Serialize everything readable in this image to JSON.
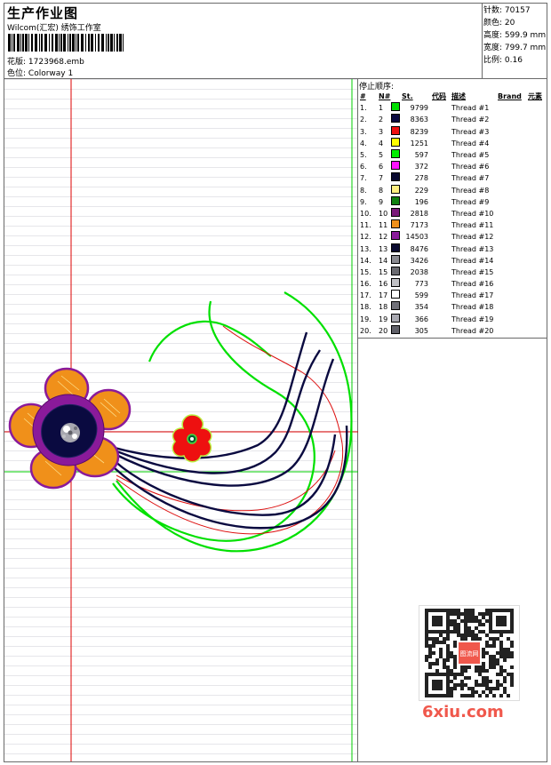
{
  "header": {
    "title": "生产作业图",
    "subtitle": "Wilcom(汇宏) 绣饰工作室",
    "design_label": "花版:",
    "design_value": "1723968.emb",
    "colorway_label": "色位:",
    "colorway_value": "Colorway 1"
  },
  "stats": [
    {
      "label": "针数:",
      "value": "70157"
    },
    {
      "label": "颜色:",
      "value": "20"
    },
    {
      "label": "高度:",
      "value": "599.9 mm"
    },
    {
      "label": "宽度:",
      "value": "799.7 mm"
    },
    {
      "label": "比例:",
      "value": "0.16"
    }
  ],
  "threads_panel": {
    "title": "停止顺序:",
    "columns": [
      "#",
      "N#",
      "St.",
      "代码",
      "描述",
      "Brand",
      "元素"
    ],
    "rows": [
      {
        "idx": "1.",
        "no": "1",
        "color": "#00e000",
        "st": "9799",
        "desc": "Thread #1"
      },
      {
        "idx": "2.",
        "no": "2",
        "color": "#0a0a40",
        "st": "8363",
        "desc": "Thread #2"
      },
      {
        "idx": "3.",
        "no": "3",
        "color": "#ee1010",
        "st": "8239",
        "desc": "Thread #3"
      },
      {
        "idx": "4.",
        "no": "4",
        "color": "#ffff00",
        "st": "1251",
        "desc": "Thread #4"
      },
      {
        "idx": "5.",
        "no": "5",
        "color": "#00ee00",
        "st": "597",
        "desc": "Thread #5"
      },
      {
        "idx": "6.",
        "no": "6",
        "color": "#ff10ff",
        "st": "372",
        "desc": "Thread #6"
      },
      {
        "idx": "7.",
        "no": "7",
        "color": "#0a0a30",
        "st": "278",
        "desc": "Thread #7"
      },
      {
        "idx": "8.",
        "no": "8",
        "color": "#ffef80",
        "st": "229",
        "desc": "Thread #8"
      },
      {
        "idx": "9.",
        "no": "9",
        "color": "#108010",
        "st": "196",
        "desc": "Thread #9"
      },
      {
        "idx": "10.",
        "no": "10",
        "color": "#7a1a7a",
        "st": "2818",
        "desc": "Thread #10"
      },
      {
        "idx": "11.",
        "no": "11",
        "color": "#f0901a",
        "st": "7173",
        "desc": "Thread #11"
      },
      {
        "idx": "12.",
        "no": "12",
        "color": "#8a1a9a",
        "st": "14503",
        "desc": "Thread #12"
      },
      {
        "idx": "13.",
        "no": "13",
        "color": "#0a0a30",
        "st": "8476",
        "desc": "Thread #13"
      },
      {
        "idx": "14.",
        "no": "14",
        "color": "#8a8a90",
        "st": "3426",
        "desc": "Thread #14"
      },
      {
        "idx": "15.",
        "no": "15",
        "color": "#6a6a70",
        "st": "2038",
        "desc": "Thread #15"
      },
      {
        "idx": "16.",
        "no": "16",
        "color": "#c0c0c4",
        "st": "773",
        "desc": "Thread #16"
      },
      {
        "idx": "17.",
        "no": "17",
        "color": "#ffffff",
        "st": "599",
        "desc": "Thread #17"
      },
      {
        "idx": "18.",
        "no": "18",
        "color": "#707078",
        "st": "354",
        "desc": "Thread #18"
      },
      {
        "idx": "19.",
        "no": "19",
        "color": "#a8a8b0",
        "st": "366",
        "desc": "Thread #19"
      },
      {
        "idx": "20.",
        "no": "20",
        "color": "#606068",
        "st": "305",
        "desc": "Thread #20"
      }
    ]
  },
  "watermark": {
    "text": "6xiu.com",
    "stamp_text": "图流网",
    "accent": "#f0584c"
  },
  "colors": {
    "crosshair_red": "#dd0000",
    "crosshair_green": "#00cc00",
    "navy": "#0a0a40",
    "green": "#00e000",
    "orange": "#f0901a",
    "purple": "#8a1a9a",
    "red": "#ee1010"
  }
}
